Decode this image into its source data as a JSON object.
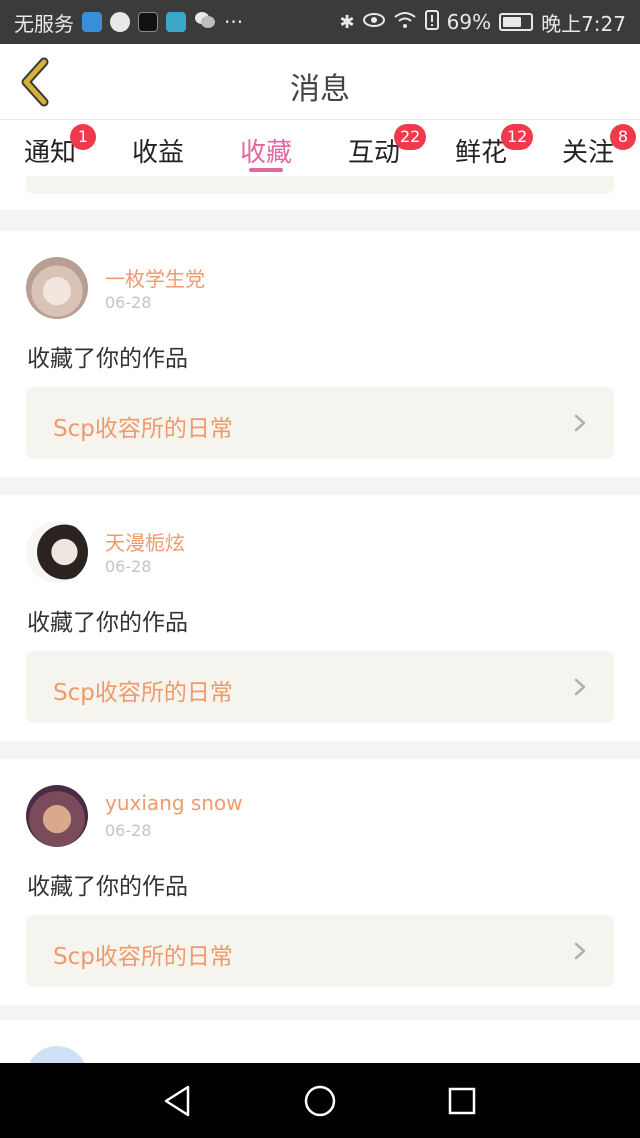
{
  "status_bar": {
    "carrier": "无服务",
    "app_icons": [
      "shield-app-icon",
      "news-app-icon",
      "tiktok-app-icon",
      "book-app-icon",
      "wechat-icon"
    ],
    "more": "···",
    "battery": "69%",
    "battery_level": 0.69,
    "time": "晚上7:27",
    "colors": {
      "background": "#3b3b3b"
    }
  },
  "header": {
    "title": "消息",
    "back_icon": "chevron-left-icon",
    "back_color": "#c9a22a"
  },
  "tabs": [
    {
      "label": "通知",
      "badge": "1"
    },
    {
      "label": "收益",
      "badge": ""
    },
    {
      "label": "收藏",
      "badge": "",
      "active": true
    },
    {
      "label": "互动",
      "badge": "22"
    },
    {
      "label": "鲜花",
      "badge": "12"
    },
    {
      "label": "关注",
      "badge": "8"
    }
  ],
  "accent_color": "#e06a9f",
  "badge_color": "#f03a4b",
  "feed": [
    {
      "user": "一枚学生党",
      "date": "06-28",
      "action": "收藏了你的作品",
      "work": "Scp收容所的日常"
    },
    {
      "user": "天漫栀炫",
      "date": "06-28",
      "action": "收藏了你的作品",
      "work": "Scp收容所的日常"
    },
    {
      "user": "yuxiang snow",
      "date": "06-28",
      "action": "收藏了你的作品",
      "work": "Scp收容所的日常"
    }
  ],
  "nav": {
    "back": "triangle-back-icon",
    "home": "circle-home-icon",
    "recent": "square-recent-icon"
  }
}
